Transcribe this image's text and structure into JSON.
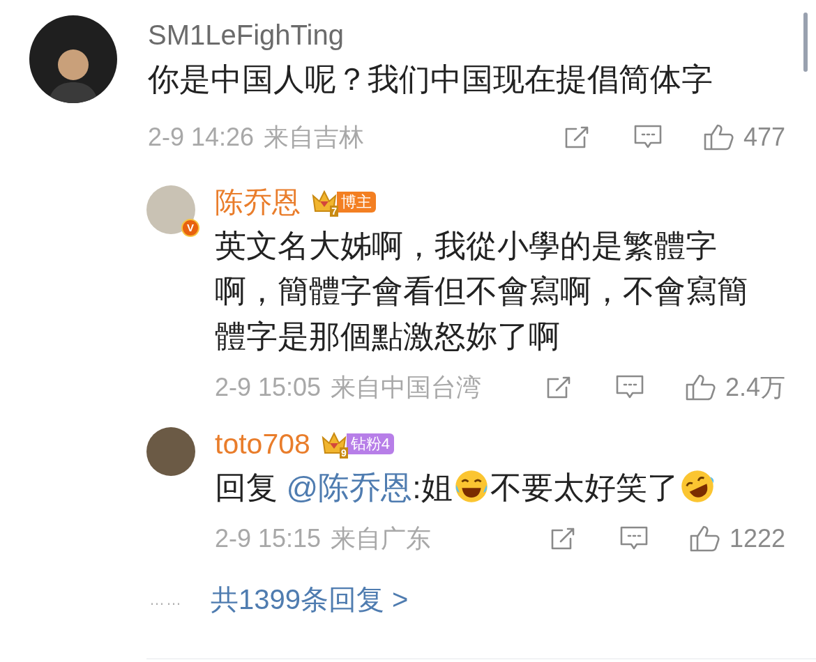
{
  "comment": {
    "user": "SM1LeFighTing",
    "text": "你是中国人呢？我们中国现在提倡简体字",
    "time": "2-9 14:26",
    "location": "来自吉林",
    "likes": "477",
    "replies": [
      {
        "user": "陈乔恩",
        "verified": true,
        "verified_mark": "V",
        "badge": {
          "kind": "blogger",
          "crown_number": "7",
          "label": "博主"
        },
        "segments": [
          {
            "kind": "text",
            "text": "英文名大姊啊，我從小學的是繁體字啊，簡體字會看但不會寫啊，不會寫簡體字是那個點激怒妳了啊"
          }
        ],
        "time": "2-9 15:05",
        "location": "来自中国台湾",
        "likes": "2.4万"
      },
      {
        "user": "toto708",
        "verified": false,
        "badge": {
          "kind": "fan",
          "crown_number": "9",
          "label": "钻粉4"
        },
        "segments": [
          {
            "kind": "text",
            "text": "回复 "
          },
          {
            "kind": "mention",
            "text": "@陈乔恩"
          },
          {
            "kind": "text",
            "text": ":姐"
          },
          {
            "kind": "laugh"
          },
          {
            "kind": "text",
            "text": "不要太好笑了"
          },
          {
            "kind": "rofl"
          }
        ],
        "time": "2-9 15:15",
        "location": "来自广东",
        "likes": "1222"
      }
    ],
    "more": {
      "dots": "……",
      "label": "共1399条回复 >"
    }
  }
}
